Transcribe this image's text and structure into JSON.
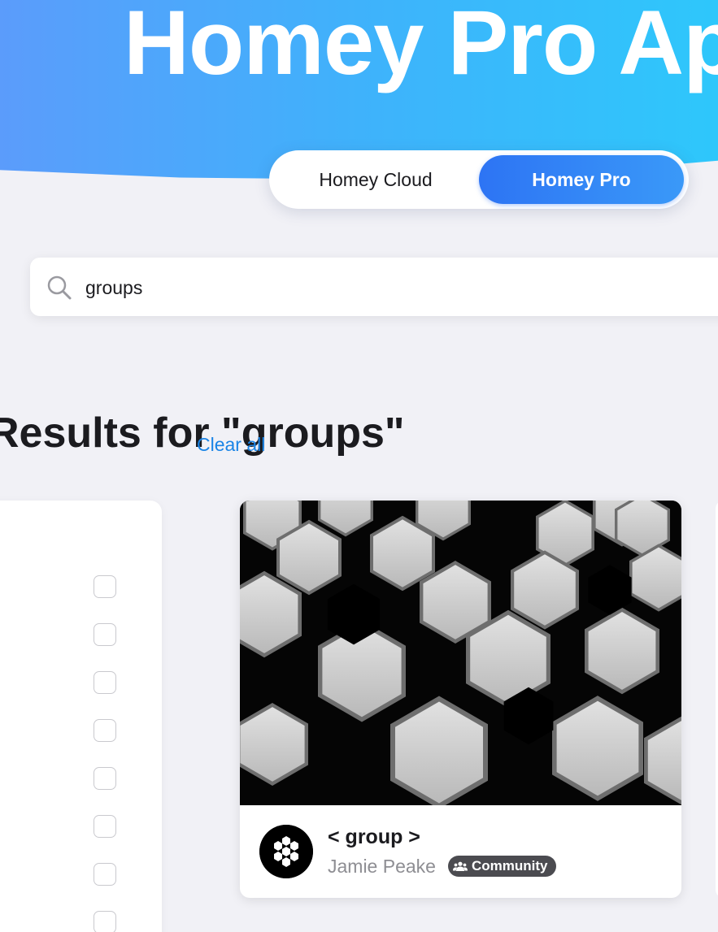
{
  "hero": {
    "title": "Homey Pro Apps"
  },
  "platform_toggle": {
    "options": [
      {
        "label": "Homey Cloud",
        "selected": false
      },
      {
        "label": "Homey Pro",
        "selected": true
      }
    ],
    "accent_color": "#2d74f4"
  },
  "search": {
    "value": "groups",
    "icon": "search-icon"
  },
  "results": {
    "heading": "Results for \"groups\"",
    "clear_label": "Clear all"
  },
  "filters": {
    "checkboxes": [
      false,
      false,
      false,
      false,
      false,
      false,
      false,
      false
    ]
  },
  "app_card": {
    "name": "< group >",
    "author": "Jamie Peake",
    "badge": "Community",
    "badge_icon": "users-icon"
  }
}
